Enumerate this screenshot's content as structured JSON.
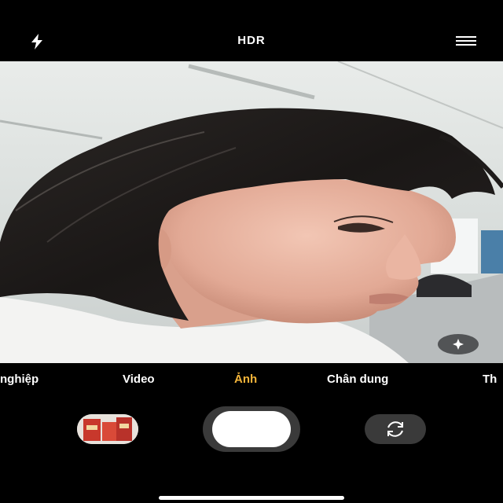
{
  "top_bar": {
    "flash_icon": "flash-icon",
    "hdr_label": "HDR",
    "menu_icon": "menu-icon"
  },
  "viewfinder": {
    "effects_icon": "sparkle-icon"
  },
  "modes": {
    "items": [
      "nghiệp",
      "Video",
      "Ảnh",
      "Chân dung",
      "Th"
    ],
    "active_index": 2
  },
  "controls": {
    "thumbnail_icon": "gallery-thumbnail",
    "shutter_icon": "shutter-button",
    "switch_icon": "camera-switch-icon"
  },
  "colors": {
    "active_mode": "#f4b53a",
    "background": "#000000",
    "control_bg": "#3a3a3a"
  }
}
